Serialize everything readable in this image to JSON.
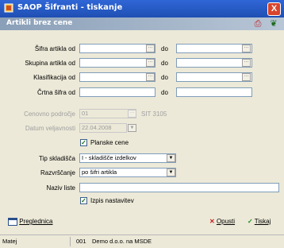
{
  "window": {
    "title": "SAOP Šifranti - tiskanje",
    "close": "X"
  },
  "header": {
    "title": "Artikli brez cene"
  },
  "labels": {
    "sifra_od": "Šifra artikla od",
    "skupina_od": "Skupina artikla od",
    "klasifikacija_od": "Klasifikacija od",
    "crtna_od": "Črtna šifra od",
    "cenovno_podrocje": "Cenovno področje",
    "datum_veljavnosti": "Datum veljavnosti",
    "do": "do",
    "tip_skladisca": "Tip skladišča",
    "razvrscanje": "Razvrščanje",
    "naziv_liste": "Naziv liste"
  },
  "fields": {
    "cenovno_value": "01",
    "cenovno_note": "SIT 3105",
    "datum_value": "22.04.2008",
    "tip_skladisca_value": "I - skladišče izdelkov",
    "razvrscanje_value": "po šifri artikla"
  },
  "checkboxes": {
    "planske_cene": "Planske cene",
    "izpis_nastavitev": "Izpis nastavitev"
  },
  "buttons": {
    "preglednica": "Preglednica",
    "opusti": "Opusti",
    "tiskaj": "Tiskaj"
  },
  "status": {
    "user": "Matej",
    "code": "001",
    "company": "Demo d.o.o. na MSDE"
  }
}
